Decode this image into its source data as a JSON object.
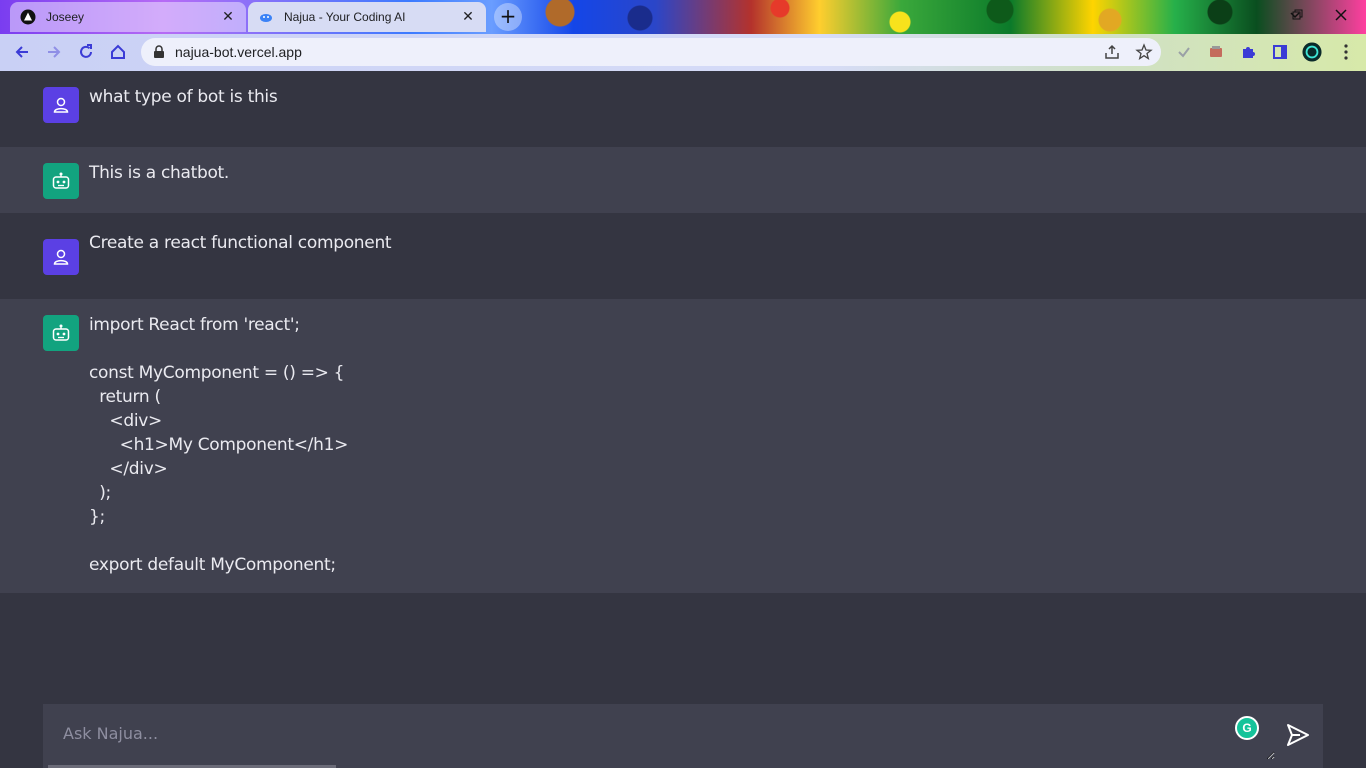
{
  "browser": {
    "tabs": [
      {
        "title": "Joseey",
        "active": false
      },
      {
        "title": "Najua - Your Coding AI",
        "active": true
      }
    ],
    "url": "najua-bot.vercel.app"
  },
  "chat": {
    "messages": [
      {
        "role": "user",
        "text": "what type of bot is this"
      },
      {
        "role": "bot",
        "text": "This is a chatbot."
      },
      {
        "role": "user",
        "text": "Create a react functional component"
      },
      {
        "role": "bot",
        "text": "import React from 'react';\n\nconst MyComponent = () => {\n  return (\n    <div>\n      <h1>My Component</h1>\n    </div>\n  );\n};\n\nexport default MyComponent;"
      }
    ]
  },
  "composer": {
    "placeholder": "Ask Najua..."
  },
  "colors": {
    "user_avatar": "#5b40e4",
    "bot_avatar": "#12a37f",
    "app_bg": "#343541",
    "bot_row_bg": "#40414f"
  }
}
